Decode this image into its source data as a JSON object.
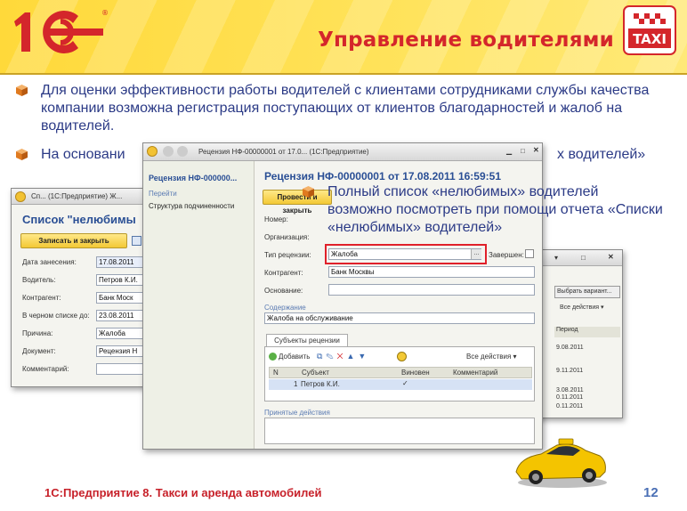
{
  "header": {
    "title": "Управление водителями",
    "logo_text": "1С",
    "taxi_label": "TAXI"
  },
  "bullets": [
    "Для оценки эффективности работы водителей с клиентами сотрудниками службы качества компании возможна регистрация поступающих от клиентов благодарностей и жалоб на водителей.",
    "На основани",
    "х водителей»",
    "Полный список «нелюбимых» водителей возможно посмотреть при помощи отчета «Списки «нелюбимых» водителей»"
  ],
  "left_window": {
    "title": "Сп...  (1С:Предприятие)  Ж...",
    "heading": "Список \"нелюбимы",
    "save_button": "Записать и закрыть",
    "fields": [
      {
        "label": "Дата занесения:",
        "value": "17.08.2011"
      },
      {
        "label": "Водитель:",
        "value": "Петров К.И."
      },
      {
        "label": "Контрагент:",
        "value": "Банк Моск"
      },
      {
        "label": "В черном списке до:",
        "value": "23.08.2011"
      },
      {
        "label": "Причина:",
        "value": "Жалоба"
      },
      {
        "label": "Документ:",
        "value": "Рецензия Н"
      },
      {
        "label": "Комментарий:",
        "value": ""
      }
    ]
  },
  "right_window": {
    "variant_button": "Выбрать вариант...",
    "all_actions": "Все действия ▾",
    "period_header": "Период",
    "dates": [
      "9.08.2011",
      "9.11.2011",
      "3.08.2011",
      "0.11.2011",
      "0.11.2011"
    ]
  },
  "main_window": {
    "title": "Рецензия НФ-00000001 от 17.0... (1С:Предприятие)",
    "sidebar_title": "Рецензия НФ-000000...",
    "sidebar_section": "Перейти",
    "sidebar_link": "Структура подчиненности",
    "doc_heading": "Рецензия НФ-00000001 от 17.08.2011 16:59:51",
    "post_close_button": "Провести и закрыть",
    "number_label": "Номер:",
    "org_label": "Организация:",
    "type_label": "Тип рецензии:",
    "type_value": "Жалоба",
    "completed_label": "Завершен:",
    "contractor_label": "Контрагент:",
    "contractor_value": "Банк Москвы",
    "basis_label": "Основание:",
    "content_header": "Содержание",
    "content_value": "Жалоба на обслуживание",
    "subjects_tab": "Субъекты рецензии",
    "add_button": "Добавить",
    "all_actions": "Все действия ▾",
    "table_headers": [
      "N",
      "Субъект",
      "Виновен",
      "Комментарий"
    ],
    "table_rows": [
      {
        "n": "1",
        "subject": "Петров К.И.",
        "guilty": "✓",
        "comment": ""
      }
    ],
    "actions_header": "Принятые действия"
  },
  "footer": {
    "text": "1С:Предприятие 8. Такси и аренда автомобилей",
    "page_number": "12"
  },
  "colors": {
    "brand_red": "#d4262b",
    "bullet_text": "#2b3a86",
    "header_yellow": "#ffd93a",
    "highlight_red": "#e0202a"
  }
}
